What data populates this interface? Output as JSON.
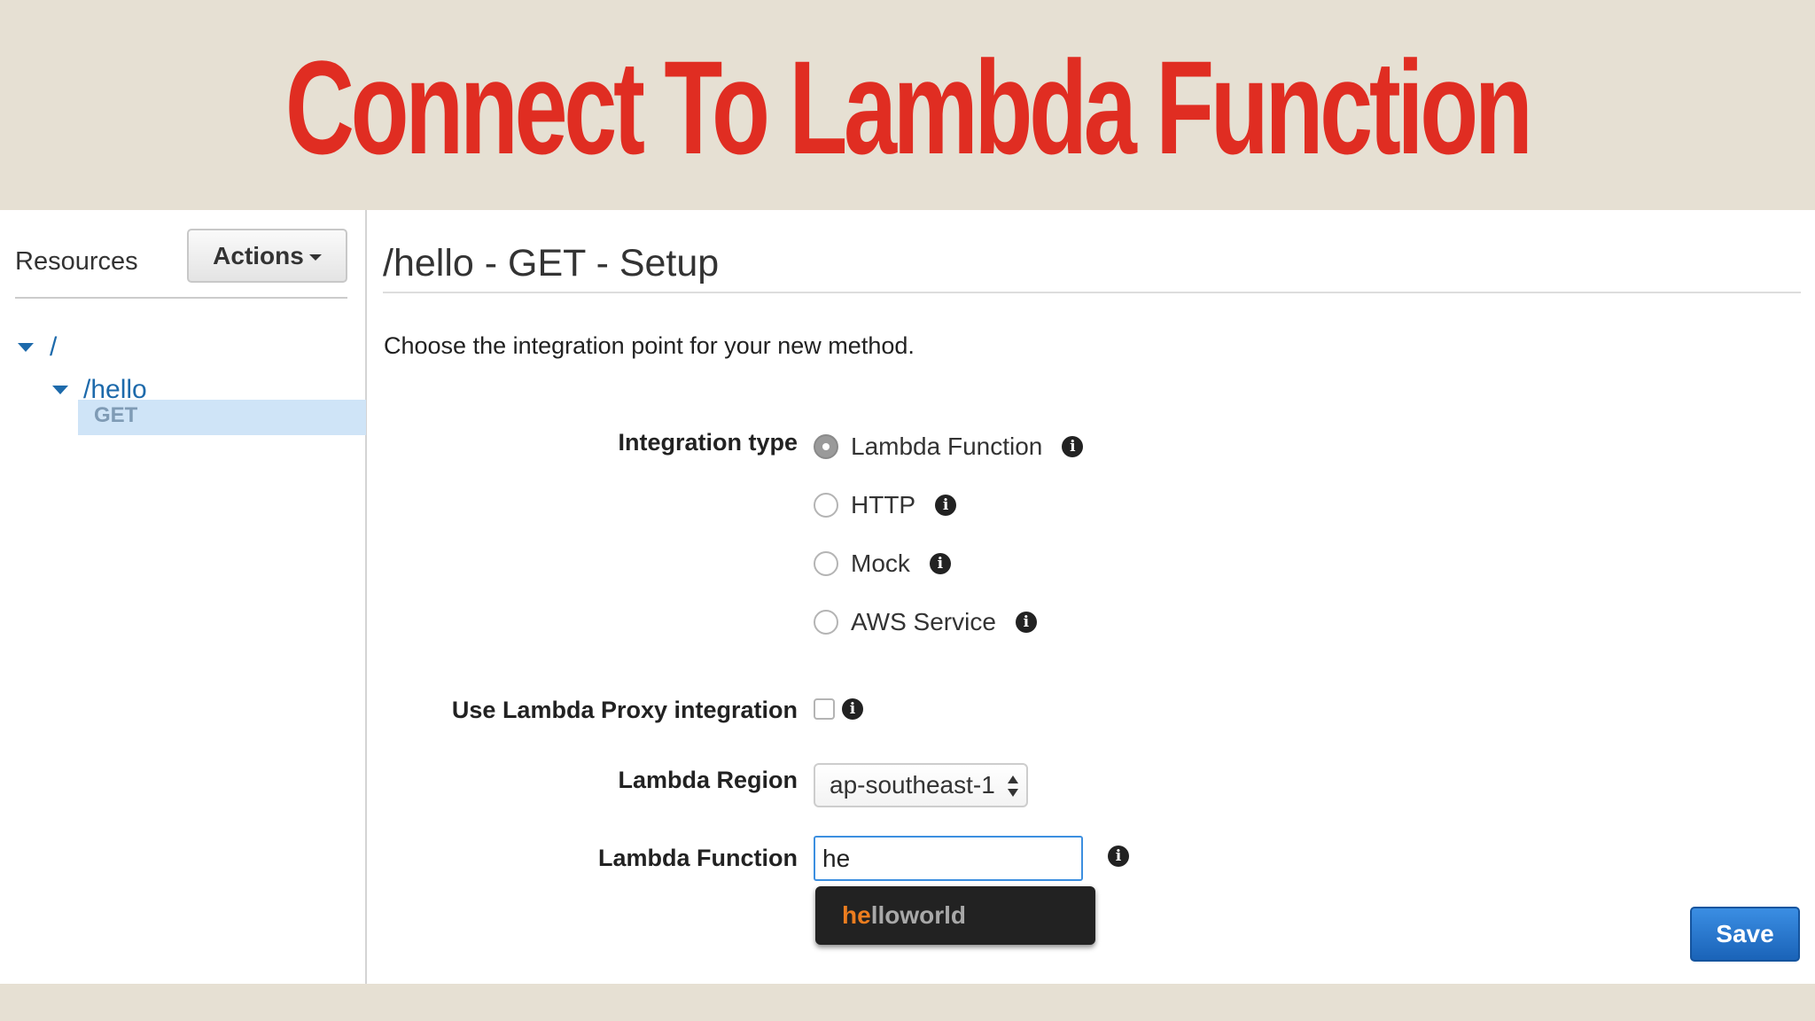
{
  "banner": {
    "title": "Connect To Lambda Function"
  },
  "sidebar": {
    "label": "Resources",
    "actions_label": "Actions",
    "tree": {
      "root": "/",
      "child": "/hello",
      "method": "GET"
    }
  },
  "main": {
    "title": "/hello - GET - Setup",
    "intro": "Choose the integration point for your new method.",
    "integration_type_label": "Integration type",
    "integration_options": [
      "Lambda Function",
      "HTTP",
      "Mock",
      "AWS Service"
    ],
    "selected_option": "Lambda Function",
    "proxy_label": "Use Lambda Proxy integration",
    "proxy_checked": false,
    "region_label": "Lambda Region",
    "region_value": "ap-southeast-1",
    "function_label": "Lambda Function",
    "function_value": "he",
    "suggestion_match": "he",
    "suggestion_rest": "lloworld",
    "save_label": "Save"
  },
  "colors": {
    "banner_bg": "#e6e0d3",
    "title_red": "#e02d22",
    "link_blue": "#1d6aab",
    "save_blue": "#1f6fc6",
    "match_orange": "#ec7d1f"
  },
  "icons": [
    "caret-down-icon",
    "info-icon",
    "select-arrows-icon"
  ]
}
